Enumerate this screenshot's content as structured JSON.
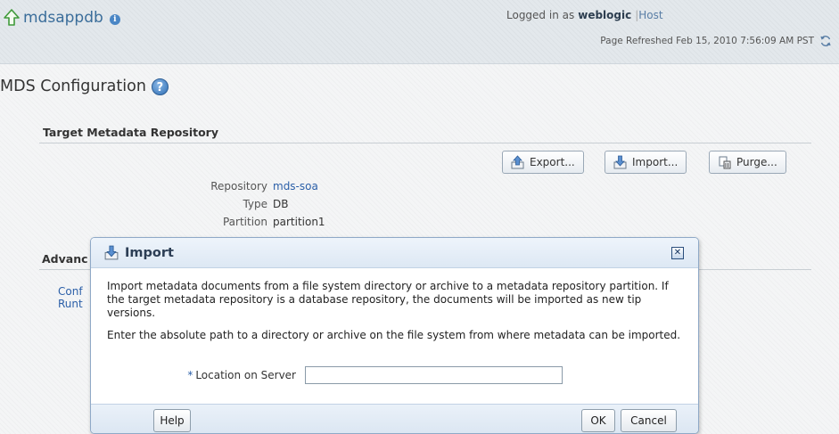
{
  "header": {
    "app_name": "mdsappdb",
    "info_glyph": "i",
    "logged_in_prefix": "Logged in as",
    "username": "weblogic",
    "separator": "|",
    "host_link": "Host",
    "page_refreshed": "Page Refreshed Feb 15, 2010 7:56:09 AM PST"
  },
  "page": {
    "title": "MDS Configuration",
    "help_glyph": "?"
  },
  "target_repo": {
    "section_title": "Target Metadata Repository",
    "buttons": {
      "export": "Export...",
      "import": "Import...",
      "purge": "Purge..."
    },
    "properties": [
      {
        "label": "Repository",
        "value": "mds-soa"
      },
      {
        "label": "Type",
        "value": "DB"
      },
      {
        "label": "Partition",
        "value": "partition1"
      }
    ]
  },
  "advanced": {
    "section_title_partial": "Advanc",
    "link1_partial": "Conf",
    "link2_partial": "Runt"
  },
  "dialog": {
    "title": "Import",
    "close_glyph": "✕",
    "description": "Import metadata documents from a file system directory or archive to a metadata repository partition. If the target metadata repository is a database repository, the documents will be imported as new tip versions.",
    "instruction": "Enter the absolute path to a directory or archive on the file system from where metadata can be imported.",
    "required_marker": "*",
    "field_label": "Location on Server",
    "field_value": "",
    "help_button": "Help",
    "ok_button": "OK",
    "cancel_button": "Cancel"
  },
  "colors": {
    "link": "#2b5fa8",
    "title_text": "#3a6d9a",
    "dialog_border": "#8fa9c7"
  },
  "icons": {
    "home": "home-arrow-icon",
    "refresh": "refresh-icon",
    "export": "export-icon",
    "import": "import-icon",
    "purge": "purge-icon"
  }
}
